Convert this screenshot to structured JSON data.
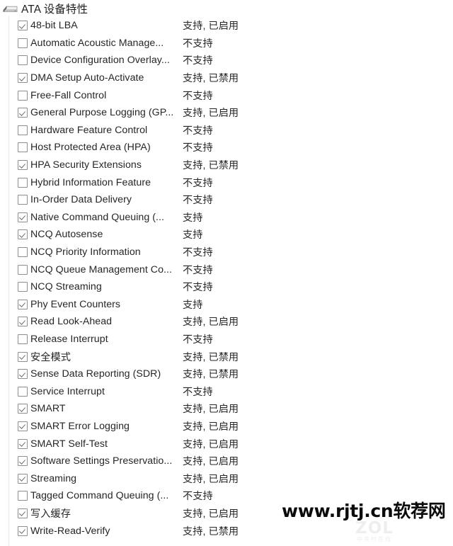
{
  "window": {
    "app_kind": "ata-device-features-list"
  },
  "group": {
    "icon": "hard-drive-icon",
    "title": "ATA 设备特性"
  },
  "status_values": {
    "supported_enabled": "支持, 已启用",
    "supported_disabled": "支持, 已禁用",
    "supported": "支持",
    "not_supported": "不支持"
  },
  "features": [
    {
      "label": "48-bit LBA",
      "checked": true,
      "status": "支持, 已启用"
    },
    {
      "label": "Automatic Acoustic Manage...",
      "checked": false,
      "status": "不支持"
    },
    {
      "label": "Device Configuration Overlay...",
      "checked": false,
      "status": "不支持"
    },
    {
      "label": "DMA Setup Auto-Activate",
      "checked": true,
      "status": "支持, 已禁用"
    },
    {
      "label": "Free-Fall Control",
      "checked": false,
      "status": "不支持"
    },
    {
      "label": "General Purpose Logging (GP...",
      "checked": true,
      "status": "支持, 已启用"
    },
    {
      "label": "Hardware Feature Control",
      "checked": false,
      "status": "不支持"
    },
    {
      "label": "Host Protected Area (HPA)",
      "checked": false,
      "status": "不支持"
    },
    {
      "label": "HPA Security Extensions",
      "checked": true,
      "status": "支持, 已禁用"
    },
    {
      "label": "Hybrid Information Feature",
      "checked": false,
      "status": "不支持"
    },
    {
      "label": "In-Order Data Delivery",
      "checked": false,
      "status": "不支持"
    },
    {
      "label": "Native Command Queuing (...",
      "checked": true,
      "status": "支持"
    },
    {
      "label": "NCQ Autosense",
      "checked": true,
      "status": "支持"
    },
    {
      "label": "NCQ Priority Information",
      "checked": false,
      "status": "不支持"
    },
    {
      "label": "NCQ Queue Management Co...",
      "checked": false,
      "status": "不支持"
    },
    {
      "label": "NCQ Streaming",
      "checked": false,
      "status": "不支持"
    },
    {
      "label": "Phy Event Counters",
      "checked": true,
      "status": "支持"
    },
    {
      "label": "Read Look-Ahead",
      "checked": true,
      "status": "支持, 已启用"
    },
    {
      "label": "Release Interrupt",
      "checked": false,
      "status": "不支持"
    },
    {
      "label": "安全模式",
      "checked": true,
      "status": "支持, 已禁用"
    },
    {
      "label": "Sense Data Reporting (SDR)",
      "checked": true,
      "status": "支持, 已禁用"
    },
    {
      "label": "Service Interrupt",
      "checked": false,
      "status": "不支持"
    },
    {
      "label": "SMART",
      "checked": true,
      "status": "支持, 已启用"
    },
    {
      "label": "SMART Error Logging",
      "checked": true,
      "status": "支持, 已启用"
    },
    {
      "label": "SMART Self-Test",
      "checked": true,
      "status": "支持, 已启用"
    },
    {
      "label": "Software Settings Preservatio...",
      "checked": true,
      "status": "支持, 已启用"
    },
    {
      "label": "Streaming",
      "checked": true,
      "status": "支持, 已启用"
    },
    {
      "label": "Tagged Command Queuing (...",
      "checked": false,
      "status": "不支持"
    },
    {
      "label": "写入缓存",
      "checked": true,
      "status": "支持, 已启用"
    },
    {
      "label": "Write-Read-Verify",
      "checked": true,
      "status": "支持, 已禁用"
    }
  ],
  "watermark": {
    "text": "www.rjtj.cn软荐网",
    "logo_mark": "ZOL",
    "logo_sub": "中关村在线"
  }
}
